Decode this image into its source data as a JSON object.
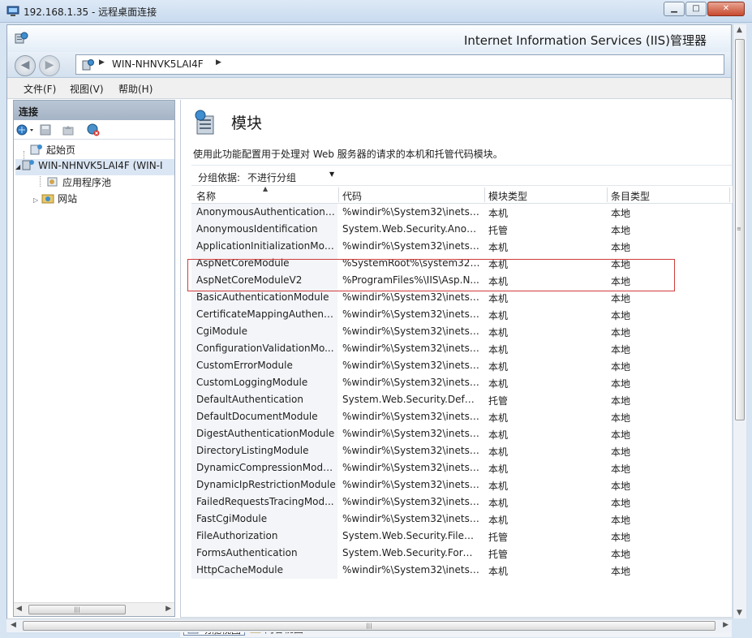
{
  "rdp": {
    "title": "192.168.1.35 - 远程桌面连接"
  },
  "window": {
    "title": "Internet Information Services (IIS)管理器"
  },
  "address": {
    "crumb": "WIN-NHNVK5LAI4F"
  },
  "menu": {
    "file": "文件(F)",
    "view": "视图(V)",
    "help": "帮助(H)"
  },
  "connections": {
    "title": "连接",
    "tree": [
      {
        "label": "起始页"
      },
      {
        "label": "WIN-NHNVK5LAI4F (WIN-I"
      },
      {
        "label": "应用程序池"
      },
      {
        "label": "网站"
      }
    ]
  },
  "page": {
    "title": "模块",
    "description": "使用此功能配置用于处理对 Web 服务器的请求的本机和托管代码模块。",
    "group_label": "分组依据:",
    "group_value": "不进行分组"
  },
  "columns": [
    "名称",
    "代码",
    "模块类型",
    "条目类型"
  ],
  "rows": [
    [
      "AnonymousAuthenticationM...",
      "%windir%\\System32\\inetsr...",
      "本机",
      "本地"
    ],
    [
      "AnonymousIdentification",
      "System.Web.Security.Anony...",
      "托管",
      "本地"
    ],
    [
      "ApplicationInitializationMod...",
      "%windir%\\System32\\inetsr...",
      "本机",
      "本地"
    ],
    [
      "AspNetCoreModule",
      "%SystemRoot%\\system32\\i...",
      "本机",
      "本地"
    ],
    [
      "AspNetCoreModuleV2",
      "%ProgramFiles%\\IIS\\Asp.N...",
      "本机",
      "本地"
    ],
    [
      "BasicAuthenticationModule",
      "%windir%\\System32\\inetsr...",
      "本机",
      "本地"
    ],
    [
      "CertificateMappingAuthenti...",
      "%windir%\\System32\\inetsr...",
      "本机",
      "本地"
    ],
    [
      "CgiModule",
      "%windir%\\System32\\inetsr...",
      "本机",
      "本地"
    ],
    [
      "ConfigurationValidationMo...",
      "%windir%\\System32\\inetsr...",
      "本机",
      "本地"
    ],
    [
      "CustomErrorModule",
      "%windir%\\System32\\inetsr...",
      "本机",
      "本地"
    ],
    [
      "CustomLoggingModule",
      "%windir%\\System32\\inetsr...",
      "本机",
      "本地"
    ],
    [
      "DefaultAuthentication",
      "System.Web.Security.Defau...",
      "托管",
      "本地"
    ],
    [
      "DefaultDocumentModule",
      "%windir%\\System32\\inetsr...",
      "本机",
      "本地"
    ],
    [
      "DigestAuthenticationModule",
      "%windir%\\System32\\inetsr...",
      "本机",
      "本地"
    ],
    [
      "DirectoryListingModule",
      "%windir%\\System32\\inetsr...",
      "本机",
      "本地"
    ],
    [
      "DynamicCompressionModule",
      "%windir%\\System32\\inetsr...",
      "本机",
      "本地"
    ],
    [
      "DynamicIpRestrictionModule",
      "%windir%\\System32\\inetsr...",
      "本机",
      "本地"
    ],
    [
      "FailedRequestsTracingMod...",
      "%windir%\\System32\\inetsr...",
      "本机",
      "本地"
    ],
    [
      "FastCgiModule",
      "%windir%\\System32\\inetsr...",
      "本机",
      "本地"
    ],
    [
      "FileAuthorization",
      "System.Web.Security.FileAu...",
      "托管",
      "本地"
    ],
    [
      "FormsAuthentication",
      "System.Web.Security.Forms...",
      "托管",
      "本地"
    ],
    [
      "HttpCacheModule",
      "%windir%\\System32\\inetsr...",
      "本机",
      "本地"
    ]
  ],
  "tabs": {
    "features": "功能视图",
    "content": "内容视图"
  }
}
